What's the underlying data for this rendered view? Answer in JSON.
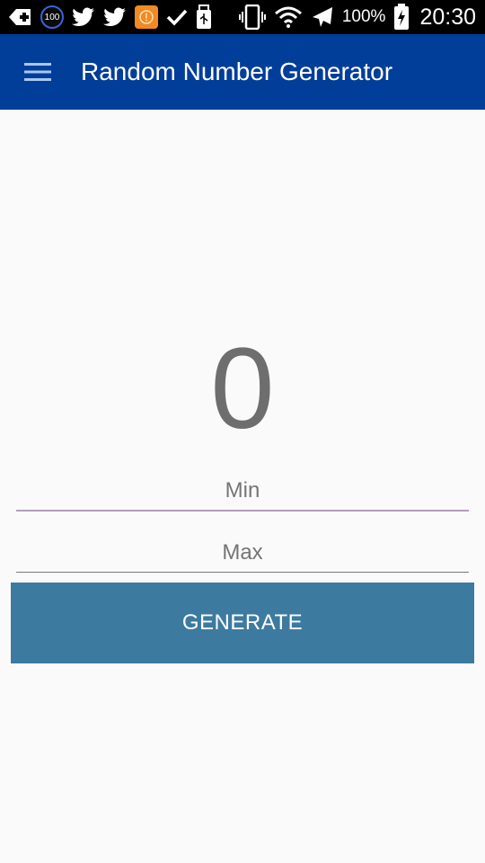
{
  "status_bar": {
    "notification_icons": [
      "plus-badge-icon",
      "badge-100-icon",
      "twitter-icon",
      "twitter-icon",
      "orange-app-icon",
      "check-icon",
      "usb-icon"
    ],
    "badge_text": "100",
    "battery_percent": "100%",
    "time": "20:30"
  },
  "app_bar": {
    "title": "Random Number Generator",
    "menu_icon": "hamburger-menu-icon",
    "color": "#003e99"
  },
  "main": {
    "result": "0",
    "min_placeholder": "Min",
    "max_placeholder": "Max",
    "generate_label": "GENERATE",
    "button_color": "#3d7aa0"
  }
}
